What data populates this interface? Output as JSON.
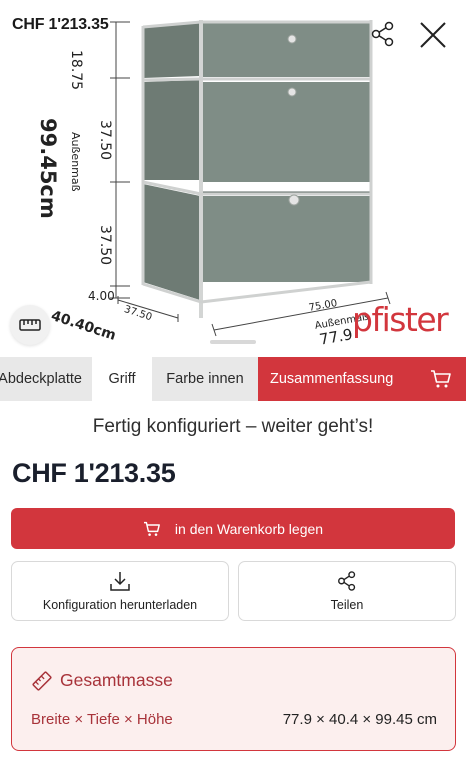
{
  "viewer": {
    "price": "CHF 1'213.35",
    "dimensions": {
      "drawer_top": "18.75",
      "drawer_middle": "37.50",
      "drawer_bottom": "37.50",
      "base": "4.00",
      "outer_label": "Außenmaß",
      "height_total": "99.45cm",
      "depth": "37.50",
      "depth_total": "40.40cm",
      "width": "75.00",
      "width_label": "Außenmaß",
      "width_total": "77.9"
    },
    "brand": "pfister",
    "icons": {
      "share": "share-icon",
      "close": "close-icon",
      "measure": "ruler-icon"
    },
    "colors": {
      "cabinet": "#7d8b84",
      "cabinet_dark": "#6b7871",
      "frame": "#c7c9c8",
      "accent": "#d2363d"
    }
  },
  "tabs": [
    {
      "label": "Abdeckplatte"
    },
    {
      "label": "Griff"
    },
    {
      "label": "Farbe innen"
    },
    {
      "label": "Zusammenfassung"
    }
  ],
  "summary": {
    "status": "Fertig konfiguriert – weiter geht’s!",
    "price": "CHF 1'213.35",
    "cart_button": "in den Warenkorb legen",
    "download_label": "Konfiguration herunterladen",
    "share_label": "Teilen",
    "dims_title": "Gesamtmasse",
    "dims_label": "Breite × Tiefe × Höhe",
    "dims_value": "77.9 × 40.4 × 99.45 cm"
  }
}
